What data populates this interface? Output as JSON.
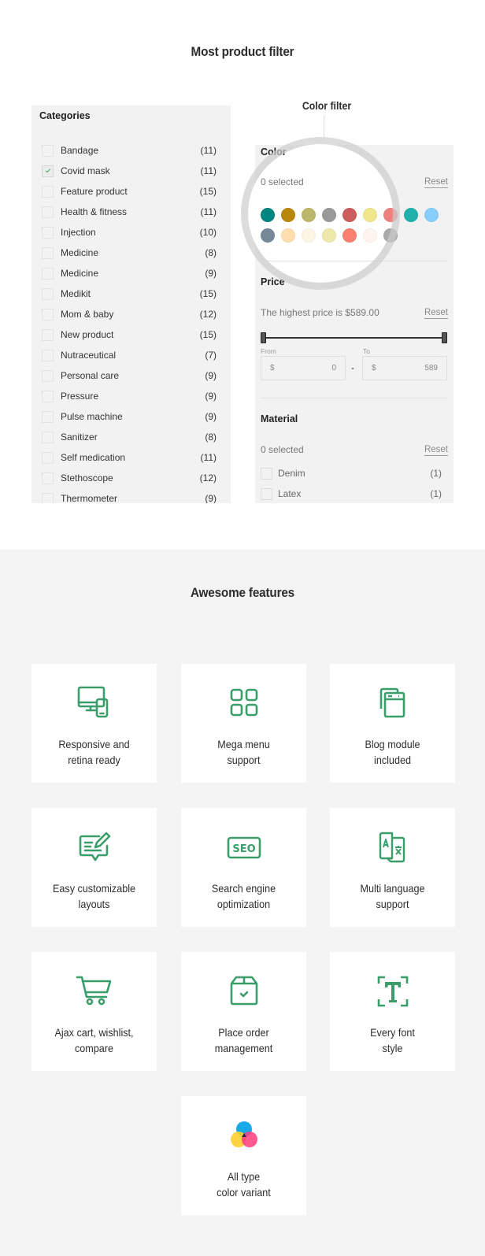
{
  "filter_section": {
    "title": "Most product filter",
    "callout_label": "Color filter"
  },
  "categories": {
    "title": "Categories",
    "items": [
      {
        "label": "Bandage",
        "count": "(11)",
        "checked": false
      },
      {
        "label": "Covid mask",
        "count": "(11)",
        "checked": true
      },
      {
        "label": "Feature product",
        "count": "(15)",
        "checked": false
      },
      {
        "label": "Health & fitness",
        "count": "(11)",
        "checked": false
      },
      {
        "label": "Injection",
        "count": "(10)",
        "checked": false
      },
      {
        "label": "Medicine",
        "count": "(8)",
        "checked": false
      },
      {
        "label": "Medicine",
        "count": "(9)",
        "checked": false
      },
      {
        "label": "Medikit",
        "count": "(15)",
        "checked": false
      },
      {
        "label": "Mom & baby",
        "count": "(12)",
        "checked": false
      },
      {
        "label": "New product",
        "count": "(15)",
        "checked": false
      },
      {
        "label": "Nutraceutical",
        "count": "(7)",
        "checked": false
      },
      {
        "label": "Personal care",
        "count": "(9)",
        "checked": false
      },
      {
        "label": "Pressure",
        "count": "(9)",
        "checked": false
      },
      {
        "label": "Pulse machine",
        "count": "(9)",
        "checked": false
      },
      {
        "label": "Sanitizer",
        "count": "(8)",
        "checked": false
      },
      {
        "label": "Self medication",
        "count": "(11)",
        "checked": false
      },
      {
        "label": "Stethoscope",
        "count": "(12)",
        "checked": false
      },
      {
        "label": "Thermometer",
        "count": "(9)",
        "checked": false
      }
    ]
  },
  "color_filter": {
    "title": "Color",
    "selected_text": "0 selected",
    "reset_label": "Reset",
    "swatches": [
      "#00857f",
      "#b8860b",
      "#bdb76b",
      "#999999",
      "#cd5c5c",
      "#f0e68c",
      "#f08080",
      "#20b2aa",
      "#87cefa",
      "#778899",
      "#ffdead",
      "#fdf5e6",
      "#eee8aa",
      "#fa8072",
      "#fff5ee",
      "#a9a9a9"
    ]
  },
  "price_filter": {
    "title": "Price",
    "highest_price_text": "The highest price is $589.00",
    "reset_label": "Reset",
    "range_min": 0,
    "range_max": 589,
    "from_label": "From",
    "to_label": "To",
    "currency": "$",
    "from_value": "0",
    "to_value": "589",
    "separator": "-"
  },
  "material_filter": {
    "title": "Material",
    "selected_text": "0 selected",
    "reset_label": "Reset",
    "items": [
      {
        "label": "Denim",
        "count": "(1)"
      },
      {
        "label": "Latex",
        "count": "(1)"
      }
    ]
  },
  "features_section": {
    "title": "Awesome features",
    "accent_color": "#3a9e6a",
    "items": [
      {
        "icon": "responsive-devices-icon",
        "line1": "Responsive and",
        "line2": "retina ready"
      },
      {
        "icon": "grid-menu-icon",
        "line1": "Mega menu",
        "line2": "support"
      },
      {
        "icon": "browser-windows-icon",
        "line1": "Blog module",
        "line2": "included"
      },
      {
        "icon": "edit-message-icon",
        "line1": "Easy customizable",
        "line2": "layouts"
      },
      {
        "icon": "seo-icon",
        "line1": "Search engine",
        "line2": "optimization"
      },
      {
        "icon": "translate-icon",
        "line1": "Multi language",
        "line2": "support"
      },
      {
        "icon": "shopping-cart-icon",
        "line1": "Ajax cart, wishlist,",
        "line2": "compare"
      },
      {
        "icon": "package-check-icon",
        "line1": "Place order",
        "line2": "management"
      },
      {
        "icon": "font-type-icon",
        "line1": "Every font",
        "line2": "style"
      },
      {
        "icon": "color-circles-icon",
        "line1": "All type",
        "line2": "color variant"
      }
    ]
  }
}
